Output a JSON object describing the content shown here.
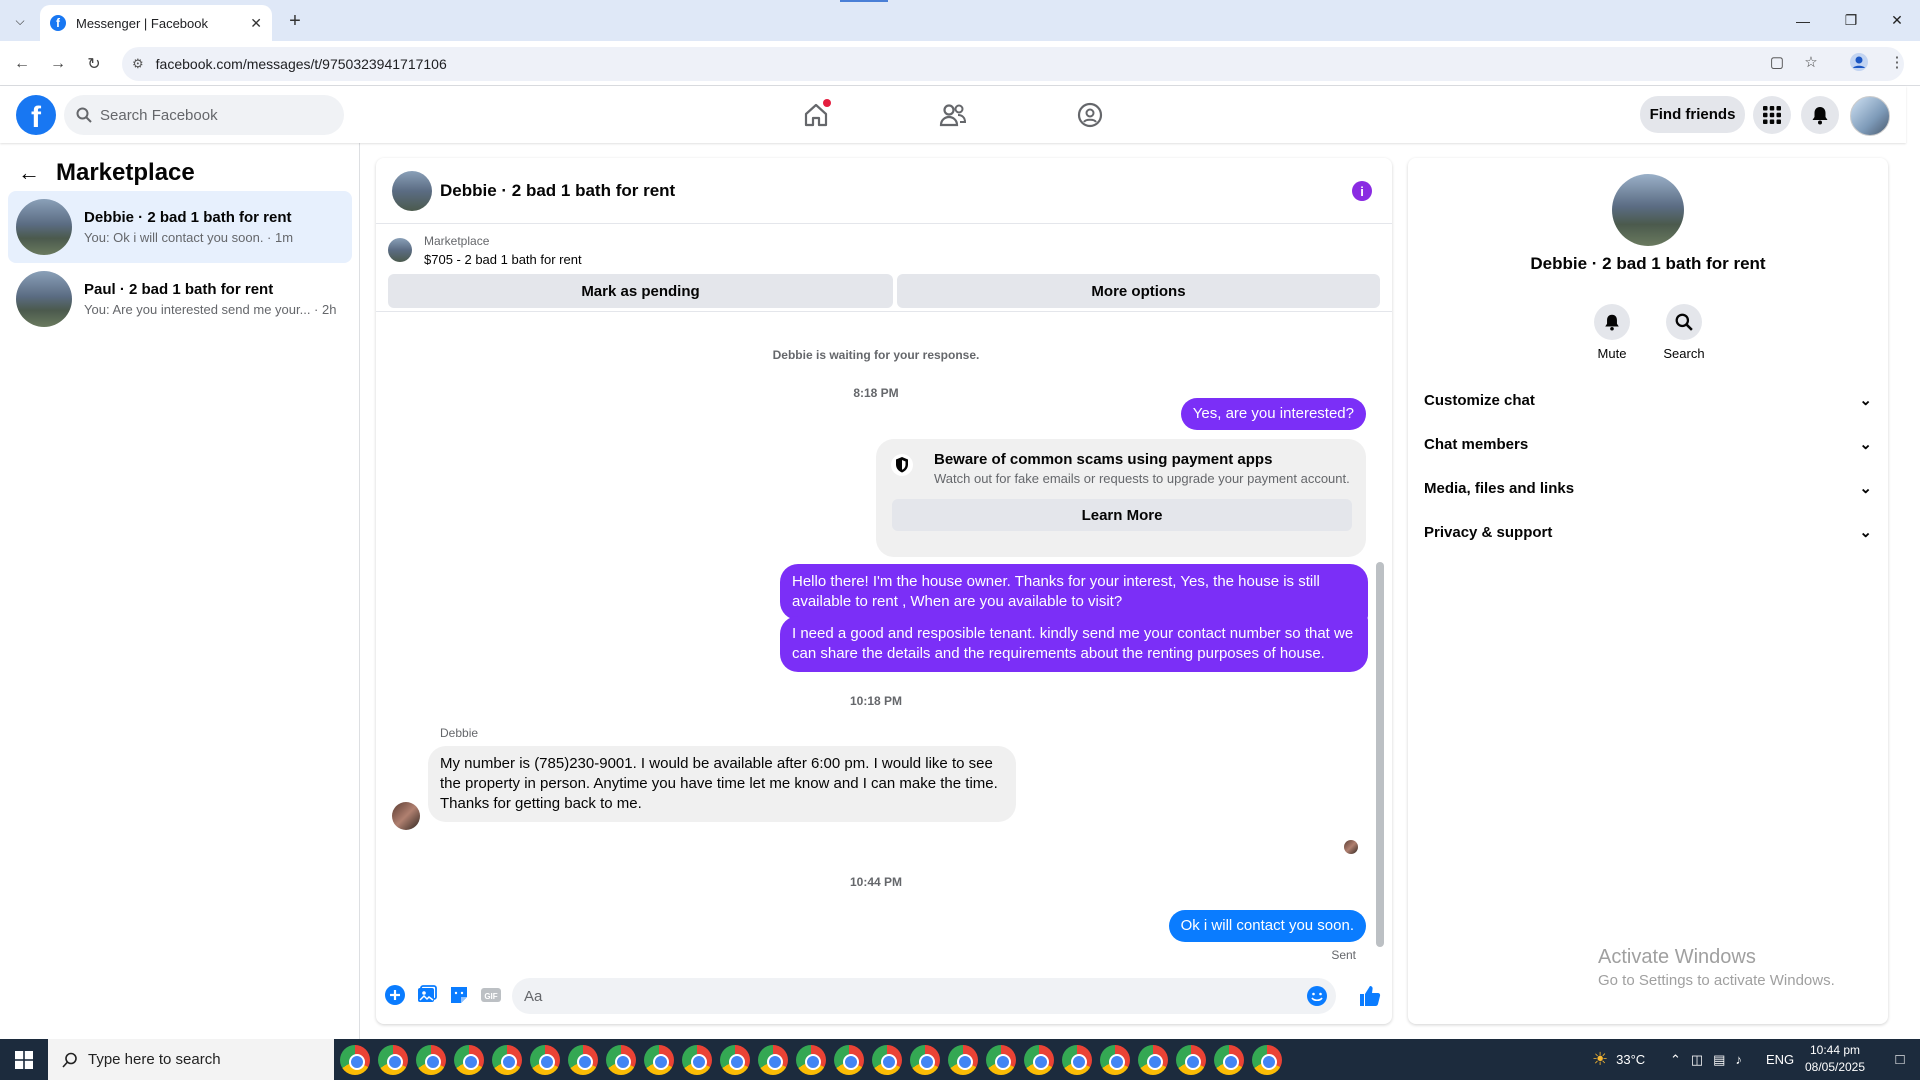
{
  "browser": {
    "tab_title": "Messenger | Facebook",
    "url": "facebook.com/messages/t/9750323941717106"
  },
  "header": {
    "search_placeholder": "Search Facebook",
    "find_friends": "Find friends"
  },
  "sidebar": {
    "title": "Marketplace",
    "conversations": [
      {
        "name": "Debbie · 2 bad 1 bath for rent",
        "preview": "You: Ok i will contact you soon. · 1m",
        "active": true
      },
      {
        "name": "Paul · 2 bad 1 bath for rent",
        "preview": "You: Are you interested send me your... · 2h",
        "active": false
      }
    ]
  },
  "chat": {
    "title": "Debbie · 2 bad 1 bath for rent",
    "listing_source": "Marketplace",
    "listing_price": "$705 - 2 bad 1 bath for rent",
    "mark_pending": "Mark as pending",
    "more_options": "More options",
    "waiting_notice": "Debbie is waiting for your response.",
    "time_1": "8:18 PM",
    "msg_1": "Yes, are you interested?",
    "scam_title": "Beware of common scams using payment apps",
    "scam_sub": "Watch out for fake emails or requests to upgrade your payment account.",
    "learn_more": "Learn More",
    "msg_2": "Hello there! I'm the house owner. Thanks for your interest, Yes, the house is still available to rent , When are you available to visit?",
    "msg_3": "I need a good and resposible tenant.  kindly send me your contact number so that we can share the details and the requirements about the renting purposes of house.",
    "time_2": "10:18 PM",
    "sender_name": "Debbie",
    "msg_4": "My number is (785)230-9001. I would be available after 6:00 pm. I would like to see the property in person.  Anytime you have time let me know and I can make the time. Thanks for getting back to me.",
    "time_3": "10:44 PM",
    "msg_5": "Ok i will contact you soon.",
    "status": "Sent",
    "composer_placeholder": "Aa"
  },
  "details": {
    "name": "Debbie · 2 bad 1 bath for rent",
    "mute": "Mute",
    "search": "Search",
    "items": [
      "Customize chat",
      "Chat members",
      "Media, files and links",
      "Privacy & support"
    ],
    "watermark_title": "Activate Windows",
    "watermark_sub": "Go to Settings to activate Windows."
  },
  "taskbar": {
    "search_placeholder": "Type here to search",
    "temperature": "33°C",
    "language": "ENG",
    "time": "10:44 pm",
    "date": "08/05/2025"
  },
  "colors": {
    "fb_blue": "#1877f2",
    "outgoing_purple": "#7b2ff7",
    "outgoing_blue": "#0a7cff"
  }
}
